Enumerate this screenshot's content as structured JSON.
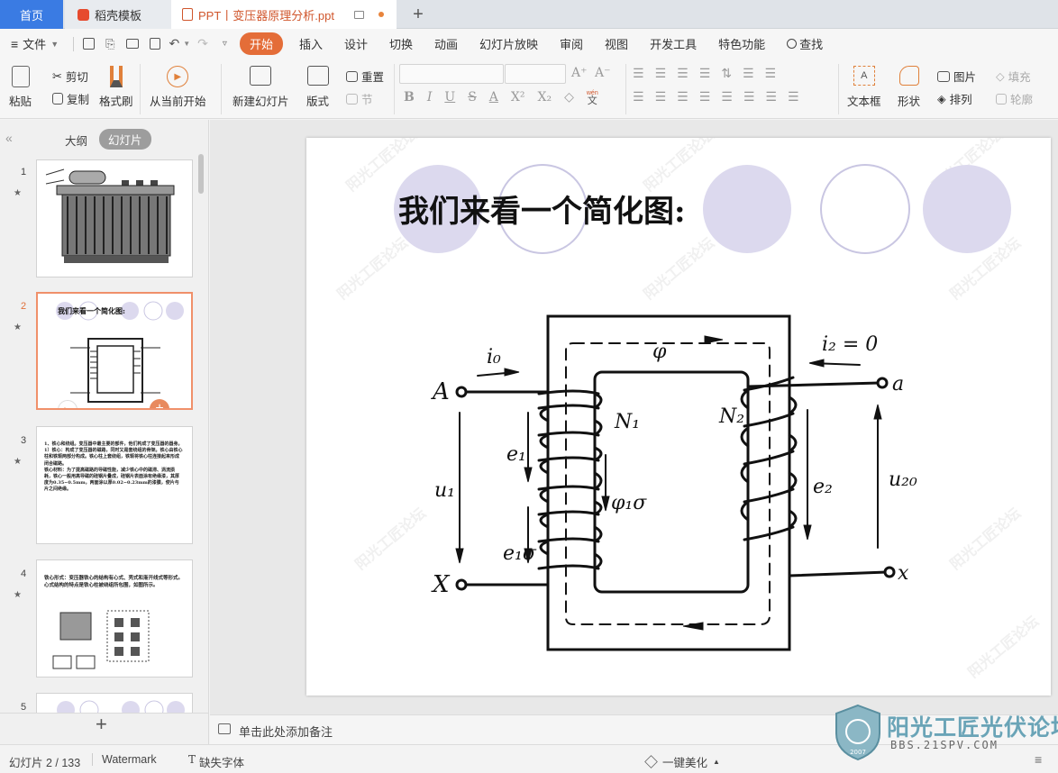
{
  "tabs": {
    "home": "首页",
    "template": "稻壳模板",
    "document": "PPT丨变压器原理分析.ppt",
    "add": "+"
  },
  "menu": {
    "file": "文件",
    "items": [
      "开始",
      "插入",
      "设计",
      "切换",
      "动画",
      "幻灯片放映",
      "审阅",
      "视图",
      "开发工具",
      "特色功能"
    ],
    "search": "查找"
  },
  "ribbon": {
    "paste": "粘贴",
    "cut": "剪切",
    "copy": "复制",
    "format_painter": "格式刷",
    "play_from_current": "从当前开始",
    "new_slide": "新建幻灯片",
    "layout": "版式",
    "reset": "重置",
    "section": "节",
    "textbox": "文本框",
    "shape": "形状",
    "picture": "图片",
    "fill": "填充",
    "arrange": "排列",
    "outline": "轮廓",
    "pinyin": "wén",
    "pinyin_char": "文"
  },
  "panel": {
    "outline_tab": "大纲",
    "slides_tab": "幻灯片",
    "add": "+"
  },
  "thumbnails": [
    {
      "num": "1",
      "star": "★",
      "kind": "transformer-photo"
    },
    {
      "num": "2",
      "star": "★",
      "kind": "simplified-diagram",
      "title": "我们来看一个简化图:"
    },
    {
      "num": "3",
      "star": "★",
      "kind": "text",
      "text": "1、铁心和绕组。变压器中最主要的部件，他们构成了变压器的器身。\n1）铁心：构成了变压器的磁路，同时又是套绕组的骨架。铁心由铁心柱和铁轭两部分构成。铁心柱上套绕组，铁轭将铁心柱连接起来形成闭合磁路。\n铁心材料：为了提高磁路的导磁性能，减少铁心中的磁滞、涡流损耗，铁心一般用高导磁的硅钢片叠成，硅钢片表面涂有绝缘漆，其厚度为0.35~0.5mm，两面涂以厚0.02~0.23mm的漆膜，使片与片之间绝缘。"
    },
    {
      "num": "4",
      "star": "★",
      "kind": "text-figure",
      "text": "铁心形式：变压器铁心的结构有心式、壳式和渐开线式等形式。心式结构的特点是铁心柱被绕组所包围，如图所示。"
    },
    {
      "num": "5",
      "star": "",
      "kind": "circles"
    }
  ],
  "slide": {
    "title": "我们来看一个简化图:",
    "labels": {
      "i0": "i₀",
      "phi": "φ",
      "i2": "i₂ = 0",
      "A": "A",
      "a": "a",
      "X": "X",
      "x": "x",
      "N1": "N₁",
      "N2": "N₂",
      "e1": "e₁",
      "e2": "e₂",
      "u1": "u₁",
      "u20": "u₂₀",
      "phi1s": "φ₁σ",
      "e1s": "e₁σ"
    },
    "watermark": "阳光工匠论坛",
    "colors": {
      "circle_fill": "#dcd9ee",
      "circle_stroke": "#c9c6e2"
    }
  },
  "notes_placeholder": "单击此处添加备注",
  "status": {
    "slide_count": "幻灯片 2 / 133",
    "theme": "Watermark",
    "missing_font": "缺失字体",
    "beautify": "一键美化"
  },
  "logo": {
    "text": "阳光工匠光伏论坛",
    "url": "BBS.21SPV.COM",
    "year": "2007"
  }
}
